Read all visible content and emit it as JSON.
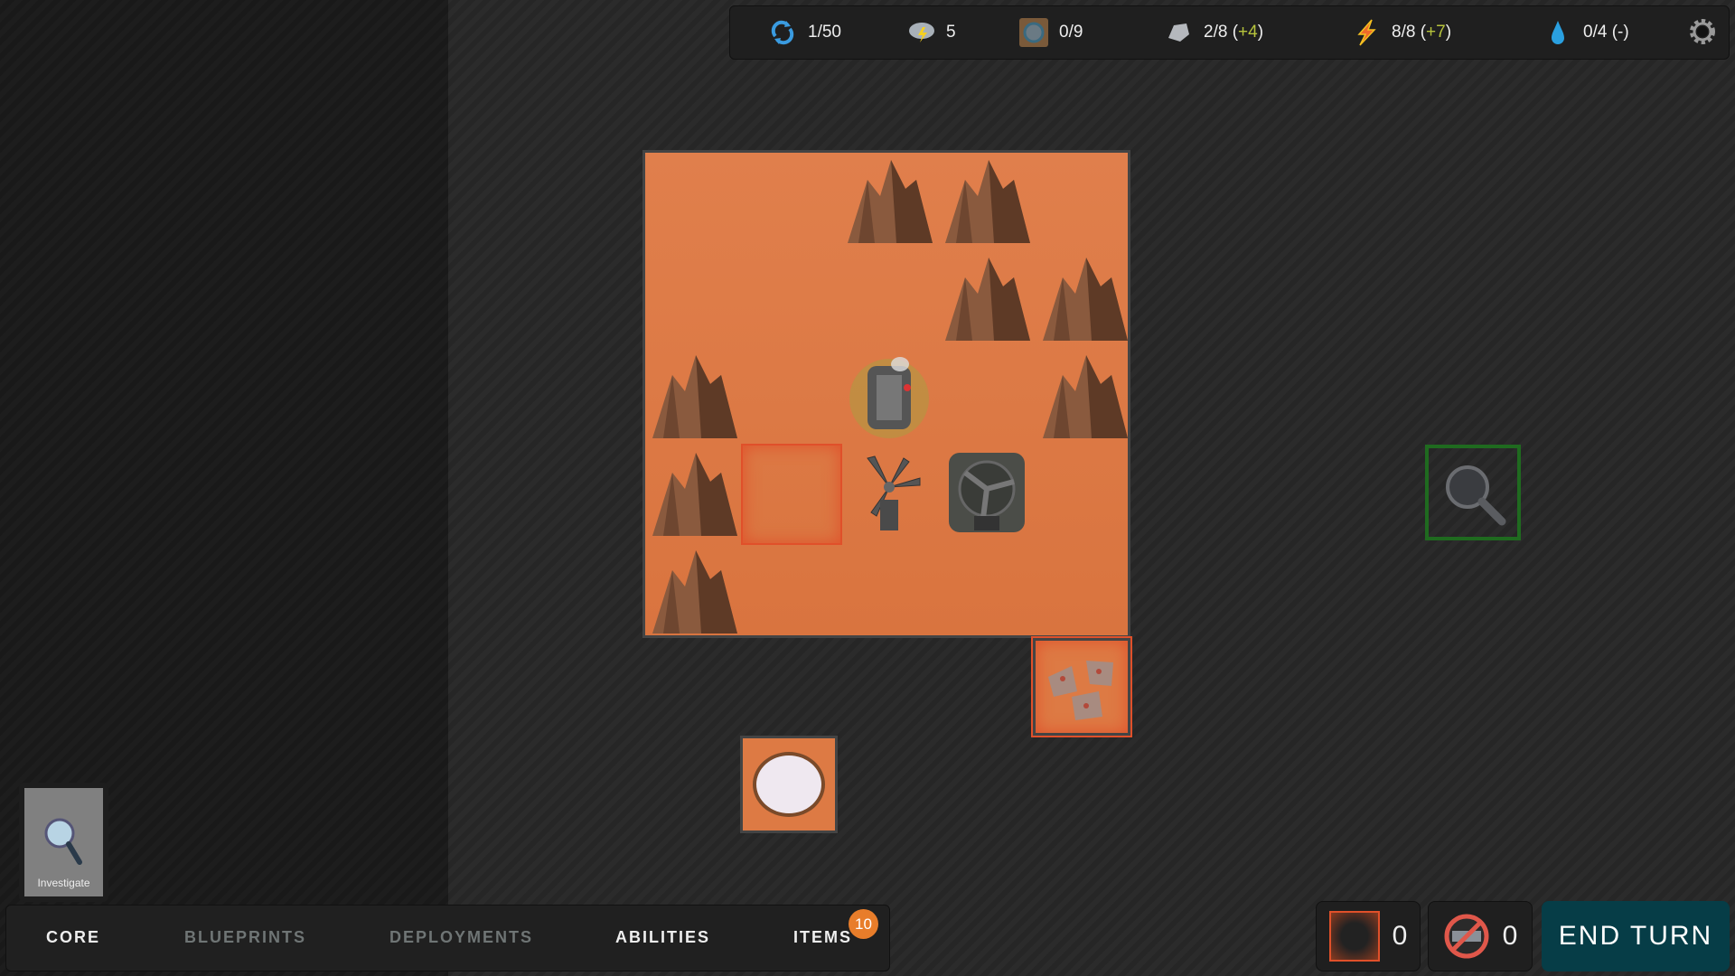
{
  "topbar": {
    "turn": {
      "icon": "cycle-icon",
      "value": "1/50"
    },
    "weather": {
      "icon": "storm-cloud-icon",
      "value": "5"
    },
    "core": {
      "icon": "core-tile-icon",
      "value": "0/9"
    },
    "metal": {
      "icon": "metal-ore-icon",
      "value": "2/8",
      "delta": "+4"
    },
    "energy": {
      "icon": "lightning-icon",
      "value": "8/8",
      "delta": "+7"
    },
    "water": {
      "icon": "water-drop-icon",
      "value": "0/4",
      "delta": "-"
    },
    "settings": "gear-icon"
  },
  "action_card": {
    "label": "Investigate"
  },
  "tabs": [
    {
      "label": "CORE"
    },
    {
      "label": "BLUEPRINTS"
    },
    {
      "label": "DEPLOYMENTS"
    },
    {
      "label": "ABILITIES"
    },
    {
      "label": "ITEMS"
    }
  ],
  "items_badge": "10",
  "counters": {
    "hazard": "0",
    "blocked": "0"
  },
  "end_turn": "END TURN",
  "colors": {
    "accent": "#063d47",
    "badge": "#e87d2a",
    "highlight": "#e0502a",
    "positive": "#b7c43c"
  }
}
